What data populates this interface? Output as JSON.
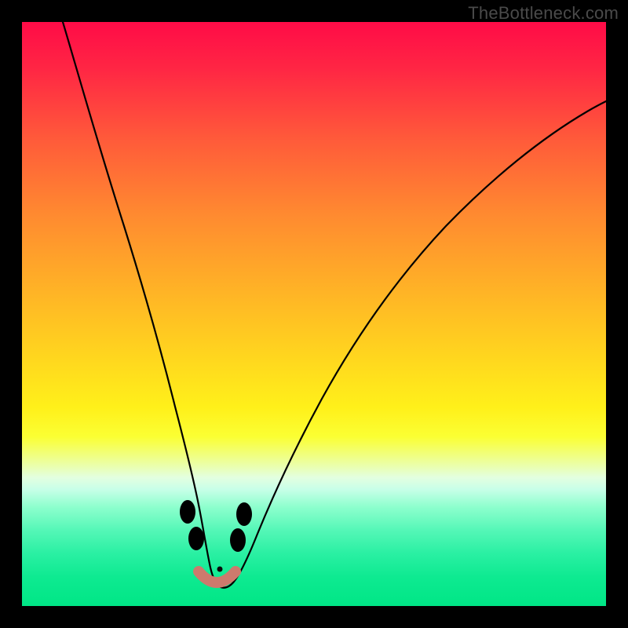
{
  "watermark": "TheBottleneck.com",
  "colors": {
    "frame": "#000000",
    "curve": "#000000",
    "marker_fill": "#cd7a6d",
    "marker_dot": "#0a0a0a"
  },
  "chart_data": {
    "type": "line",
    "title": "",
    "xlabel": "",
    "ylabel": "",
    "xlim": [
      0,
      100
    ],
    "ylim": [
      0,
      100
    ],
    "grid": false,
    "note": "Background gradient encodes a scalar from high (red, top) to low (green, bottom); the black curve is a V-shaped bottleneck profile reaching its minimum near x≈33.",
    "series": [
      {
        "name": "bottleneck_curve",
        "x": [
          7,
          10,
          14,
          18,
          22,
          25,
          27,
          29,
          31,
          33,
          35,
          37,
          40,
          45,
          52,
          60,
          70,
          82,
          95,
          100
        ],
        "values": [
          100,
          88,
          74,
          60,
          45,
          33,
          23,
          14,
          7,
          3,
          3,
          5,
          10,
          20,
          34,
          48,
          62,
          75,
          86,
          90
        ]
      }
    ],
    "markers": [
      {
        "x": 27.5,
        "y": 14,
        "kind": "pill"
      },
      {
        "x": 36.5,
        "y": 13,
        "kind": "pill"
      },
      {
        "x": 32.0,
        "y": 4.5,
        "kind": "dot"
      }
    ],
    "valley_path": {
      "start_x": 28.5,
      "end_x": 35.5,
      "y": 3
    }
  }
}
